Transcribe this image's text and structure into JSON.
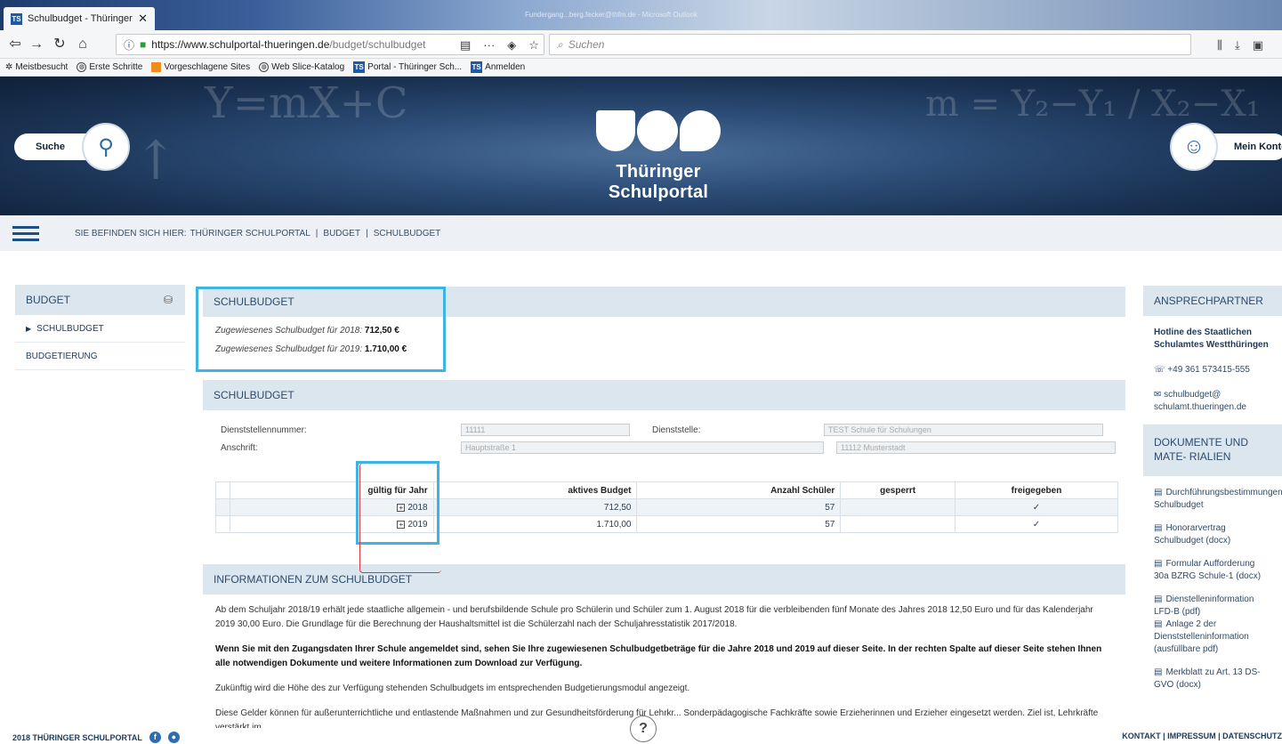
{
  "browser": {
    "tab_title": "Schulbudget - Thüringer Schul",
    "tab_close": "✕",
    "titlebar_account": "Fundergang...berg.fecker@thfm.de - Microsoft Outlook",
    "url_host": "https://www.schulportal-thueringen.de",
    "url_path": "/budget/schulbudget",
    "search_placeholder": "Suchen",
    "bookmarks": [
      "Meistbesucht",
      "Erste Schritte",
      "Vorgeschlagene Sites",
      "Web Slice-Katalog",
      "Portal - Thüringer Sch...",
      "Anmelden"
    ]
  },
  "header": {
    "search_label": "Suche",
    "account_label": "Mein Konto",
    "logo_text": "Thüringer Schulportal"
  },
  "breadcrumb": {
    "label": "SIE BEFINDEN SICH HIER:",
    "items": [
      "THÜRINGER SCHULPORTAL",
      "BUDGET",
      "SCHULBUDGET"
    ],
    "sep": "|"
  },
  "left_nav": {
    "title": "BUDGET",
    "items": [
      "SCHULBUDGET",
      "BUDGETIERUNG"
    ]
  },
  "summary": {
    "title": "SCHULBUDGET",
    "line1_label": "Zugewiesenes Schulbudget für 2018:",
    "line1_value": "712,50 €",
    "line2_label": "Zugewiesenes Schulbudget für 2019:",
    "line2_value": "1.710,00 €"
  },
  "detail": {
    "title": "SCHULBUDGET",
    "fields": {
      "dienststellennummer_label": "Dienststellennummer:",
      "dienststellennummer_value": "11111",
      "dienststelle_label": "Dienststelle:",
      "dienststelle_value": "TEST Schule für Schulungen",
      "anschrift_label": "Anschrift:",
      "anschrift_street": "Hauptstraße 1",
      "anschrift_city": "11112 Musterstadt"
    },
    "table": {
      "headers": [
        "gültig für Jahr",
        "aktives Budget",
        "Anzahl Schüler",
        "gesperrt",
        "freigegeben"
      ],
      "rows": [
        {
          "year": "2018",
          "budget": "712,50",
          "students": "57",
          "locked": "",
          "released": "✓"
        },
        {
          "year": "2019",
          "budget": "1.710,00",
          "students": "57",
          "locked": "",
          "released": "✓"
        }
      ]
    }
  },
  "info": {
    "title": "INFORMATIONEN ZUM SCHULBUDGET",
    "p1": "Ab dem Schuljahr 2018/19 erhält jede staatliche allgemein - und berufsbildende Schule pro Schülerin und Schüler zum 1. August 2018 für die verbleibenden fünf Monate des Jahres 2018 12,50 Euro und für das Kalenderjahr 2019 30,00 Euro. Die Grundlage für die Berechnung der Haushaltsmittel ist die Schülerzahl nach der Schuljahresstatistik 2017/2018.",
    "p2": "Wenn Sie mit den Zugangsdaten Ihrer Schule angemeldet sind, sehen Sie Ihre zugewiesenen Schulbudgetbeträge für die Jahre 2018 und 2019 auf dieser Seite. In der rechten Spalte auf dieser Seite stehen Ihnen alle notwendigen Dokumente und weitere Informationen zum Download zur Verfügung.",
    "p3": "Zukünftig wird die Höhe des zur Verfügung stehenden Schulbudgets im entsprechenden Budgetierungsmodul angezeigt.",
    "p4": "Diese Gelder können für außerunterrichtliche und entlastende Maßnahmen und zur Gesundheitsförderung für Lehrkr... Sonderpädagogische Fachkräfte sowie Erzieherinnen und Erzieher eingesetzt werden. Ziel ist, Lehrkräfte verstärkt im"
  },
  "contact": {
    "title": "ANSPRECHPARTNER",
    "org": "Hotline des Staatlichen Schulamtes Westthüringen",
    "phone": "+49 361 573415-555",
    "email": "schulbudget@ schulamt.thueringen.de"
  },
  "documents": {
    "title": "DOKUMENTE UND MATE- RIALIEN",
    "items": [
      "Durchführungsbestimmungen Schulbudget",
      "Honorarvertrag Schulbudget (docx)",
      "Formular Aufforderung 30a BZRG Schule-1 (docx)",
      "Dienstelleninformation LFD-B (pdf)",
      "Anlage 2 der Dienststelleninformation (ausfüllbare pdf)",
      "Merkblatt zu Art. 13 DS-GVO (docx)"
    ]
  },
  "footer": {
    "copyright": "2018 THÜRINGER SCHULPORTAL",
    "links": "KONTAKT | IMPRESSUM | DATENSCHUTZ",
    "help": "?"
  },
  "colors": {
    "accent_highlight": "#3db3e6",
    "annotation_red": "#d43a3a",
    "panel_header": "#dbe6ef",
    "brand_blue": "#1d4f87"
  }
}
